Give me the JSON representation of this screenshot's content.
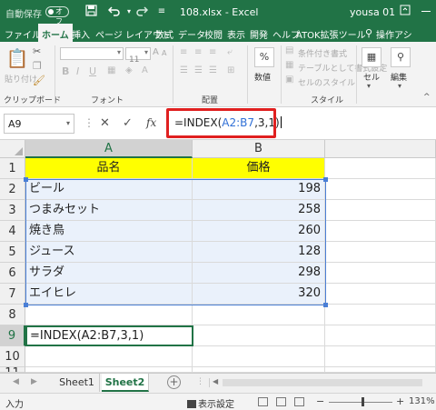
{
  "titlebar": {
    "autosave_label": "自動保存",
    "autosave_state": "オフ",
    "filename": "108.xlsx",
    "separator": "-",
    "app": "Excel",
    "user": "yousa 01"
  },
  "ribbon_tabs": [
    "ファイル",
    "ホーム",
    "挿入",
    "ページ レイアウト",
    "数式",
    "データ",
    "校閲",
    "表示",
    "開発",
    "ヘルプ",
    "ATOK拡張ツール",
    "操作アシ"
  ],
  "ribbon": {
    "paste_label": "貼り付け",
    "font_name": "",
    "font_size": "11",
    "cond_format": "条件付き書式",
    "table_format": "テーブルとして書式設定",
    "cell_style": "セルのスタイル",
    "number_label": "数値",
    "cell_label": "セル",
    "edit_label": "編集",
    "group_clipboard": "クリップボード",
    "group_font": "フォント",
    "group_align": "配置",
    "group_style": "スタイル"
  },
  "formula_bar": {
    "name_box": "A9",
    "formula_prefix": "=INDEX(",
    "formula_ref": "A2:B7",
    "formula_suffix": ",3,1)"
  },
  "columns": [
    "A",
    "B"
  ],
  "rows": [
    "1",
    "2",
    "3",
    "4",
    "5",
    "6",
    "7",
    "8",
    "9",
    "10",
    "11"
  ],
  "cells": {
    "header": [
      "品名",
      "価格"
    ],
    "data": [
      [
        "ビール",
        "198"
      ],
      [
        "つまみセット",
        "258"
      ],
      [
        "焼き鳥",
        "260"
      ],
      [
        "ジュース",
        "128"
      ],
      [
        "サラダ",
        "298"
      ],
      [
        "エイヒレ",
        "320"
      ]
    ],
    "a9": "=INDEX(A2:B7,3,1)"
  },
  "sheets": [
    "Sheet1",
    "Sheet2"
  ],
  "active_sheet": "Sheet2",
  "statusbar": {
    "mode": "入力",
    "display_settings": "表示設定",
    "zoom": "131%"
  },
  "colors": {
    "excel_green": "#217346",
    "header_fill": "#ffff00",
    "highlight_border": "#e02020",
    "reference_blue": "#4a7fd6"
  }
}
